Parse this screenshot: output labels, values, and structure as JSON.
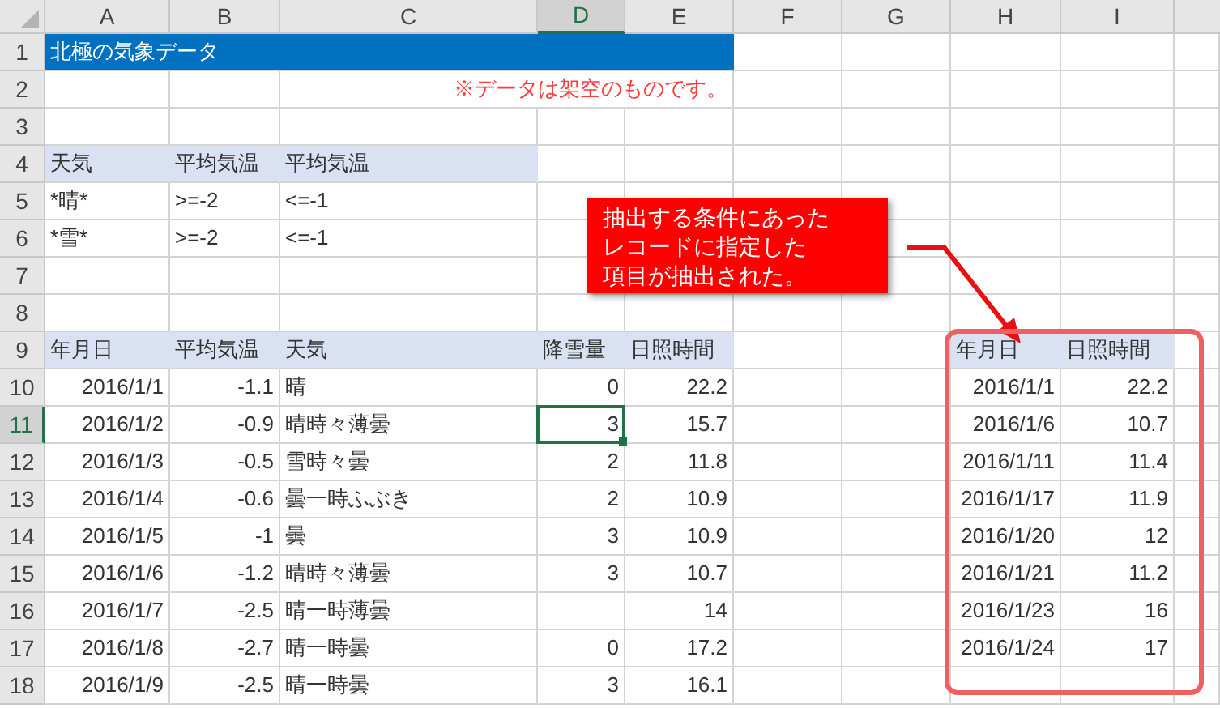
{
  "columns": [
    {
      "label": "A",
      "selected": false
    },
    {
      "label": "B",
      "selected": false
    },
    {
      "label": "C",
      "selected": false
    },
    {
      "label": "D",
      "selected": true
    },
    {
      "label": "E",
      "selected": false
    },
    {
      "label": "F",
      "selected": false
    },
    {
      "label": "G",
      "selected": false
    },
    {
      "label": "H",
      "selected": false
    },
    {
      "label": "I",
      "selected": false
    }
  ],
  "row_numbers": [
    {
      "label": "1",
      "selected": false
    },
    {
      "label": "2",
      "selected": false
    },
    {
      "label": "3",
      "selected": false
    },
    {
      "label": "4",
      "selected": false
    },
    {
      "label": "5",
      "selected": false
    },
    {
      "label": "6",
      "selected": false
    },
    {
      "label": "7",
      "selected": false
    },
    {
      "label": "8",
      "selected": false
    },
    {
      "label": "9",
      "selected": false
    },
    {
      "label": "10",
      "selected": false
    },
    {
      "label": "11",
      "selected": true
    },
    {
      "label": "12",
      "selected": false
    },
    {
      "label": "13",
      "selected": false
    },
    {
      "label": "14",
      "selected": false
    },
    {
      "label": "15",
      "selected": false
    },
    {
      "label": "16",
      "selected": false
    },
    {
      "label": "17",
      "selected": false
    },
    {
      "label": "18",
      "selected": false
    }
  ],
  "title": "北極の気象データ",
  "note": "※データは架空のものです。",
  "criteria": {
    "headers": [
      "天気",
      "平均気温",
      "平均気温"
    ],
    "rows": [
      [
        "*晴*",
        ">=-2",
        "<=-1"
      ],
      [
        "*雪*",
        ">=-2",
        "<=-1"
      ]
    ]
  },
  "table": {
    "headers": [
      "年月日",
      "平均気温",
      "天気",
      "降雪量",
      "日照時間"
    ],
    "rows": [
      [
        "2016/1/1",
        "-1.1",
        "晴",
        "0",
        "22.2"
      ],
      [
        "2016/1/2",
        "-0.9",
        "晴時々薄曇",
        "3",
        "15.7"
      ],
      [
        "2016/1/3",
        "-0.5",
        "雪時々曇",
        "2",
        "11.8"
      ],
      [
        "2016/1/4",
        "-0.6",
        "曇一時ふぶき",
        "2",
        "10.9"
      ],
      [
        "2016/1/5",
        "-1",
        "曇",
        "3",
        "10.9"
      ],
      [
        "2016/1/6",
        "-1.2",
        "晴時々薄曇",
        "3",
        "10.7"
      ],
      [
        "2016/1/7",
        "-2.5",
        "晴一時薄曇",
        "",
        "14"
      ],
      [
        "2016/1/8",
        "-2.7",
        "晴一時曇",
        "0",
        "17.2"
      ],
      [
        "2016/1/9",
        "-2.5",
        "晴一時曇",
        "3",
        "16.1"
      ]
    ]
  },
  "result": {
    "headers": [
      "年月日",
      "日照時間"
    ],
    "rows": [
      [
        "2016/1/1",
        "22.2"
      ],
      [
        "2016/1/6",
        "10.7"
      ],
      [
        "2016/1/11",
        "11.4"
      ],
      [
        "2016/1/17",
        "11.9"
      ],
      [
        "2016/1/20",
        "12"
      ],
      [
        "2016/1/21",
        "11.2"
      ],
      [
        "2016/1/23",
        "16"
      ],
      [
        "2016/1/24",
        "17"
      ]
    ]
  },
  "callout": {
    "lines": [
      "抽出する条件にあった",
      "レコードに指定した",
      "項目が抽出された。"
    ]
  }
}
